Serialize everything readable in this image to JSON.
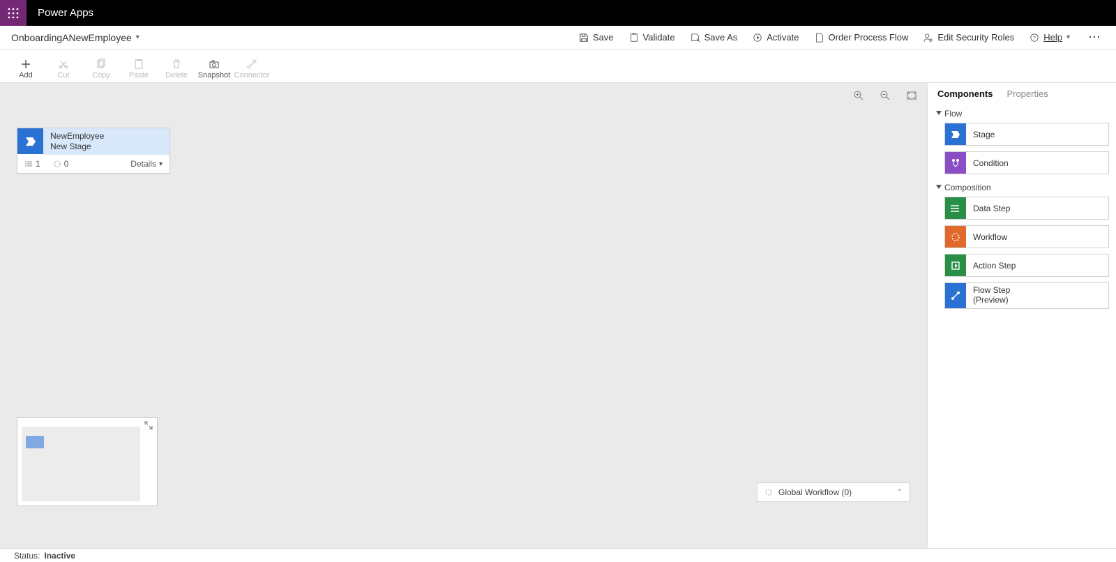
{
  "header": {
    "app_name": "Power Apps",
    "flow_name": "OnboardingANewEmployee"
  },
  "commandbar": {
    "save": "Save",
    "validate": "Validate",
    "save_as": "Save As",
    "activate": "Activate",
    "order": "Order Process Flow",
    "edit_security": "Edit Security Roles",
    "help": "Help"
  },
  "toolbar": {
    "add": "Add",
    "cut": "Cut",
    "copy": "Copy",
    "paste": "Paste",
    "delete": "Delete",
    "snapshot": "Snapshot",
    "connector": "Connector"
  },
  "stage_card": {
    "title": "NewEmployee",
    "subtitle": "New Stage",
    "steps_count": "1",
    "wf_count": "0",
    "details": "Details"
  },
  "global_workflow": {
    "label": "Global Workflow (0)"
  },
  "right_panel": {
    "tabs": {
      "components": "Components",
      "properties": "Properties"
    },
    "sections": {
      "flow": "Flow",
      "composition": "Composition"
    },
    "items": {
      "stage": "Stage",
      "condition": "Condition",
      "data_step": "Data Step",
      "workflow": "Workflow",
      "action_step": "Action Step",
      "flow_step_l1": "Flow Step",
      "flow_step_l2": "(Preview)"
    }
  },
  "status": {
    "label": "Status:",
    "value": "Inactive"
  }
}
